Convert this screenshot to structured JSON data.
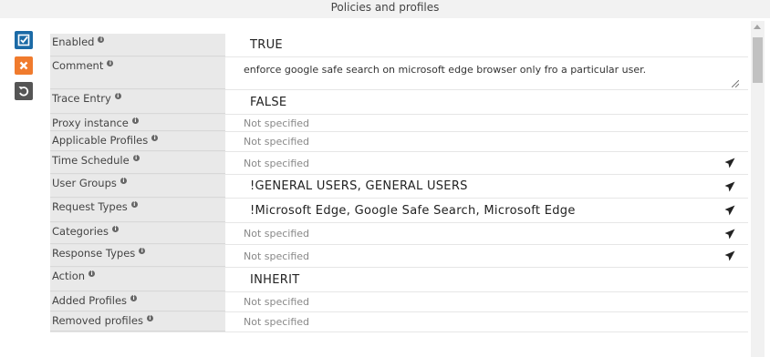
{
  "title": "Policies and profiles",
  "tools": {
    "save_icon": "check-square-icon",
    "cancel_icon": "close-icon",
    "revert_icon": "undo-icon"
  },
  "rows": [
    {
      "label": "Enabled",
      "value": "TRUE",
      "style": "big",
      "action": false
    },
    {
      "label": "Comment",
      "value": "enforce google safe search on microsoft edge browser only fro a particular user.",
      "style": "comment",
      "action": false
    },
    {
      "label": "Trace Entry",
      "value": "FALSE",
      "style": "big",
      "action": false
    },
    {
      "label": "Proxy instance",
      "value": "Not specified",
      "style": "ns",
      "action": false
    },
    {
      "label": "Applicable Profiles",
      "value": "Not specified",
      "style": "ns",
      "action": false
    },
    {
      "label": "Time Schedule",
      "value": "Not specified",
      "style": "ns",
      "action": true
    },
    {
      "label": "User Groups",
      "value": "!GENERAL USERS,   GENERAL USERS",
      "style": "big",
      "action": true
    },
    {
      "label": "Request Types",
      "value": "!Microsoft Edge,   Google Safe Search,   Microsoft Edge",
      "style": "big",
      "action": true
    },
    {
      "label": "Categories",
      "value": "Not specified",
      "style": "ns",
      "action": true
    },
    {
      "label": "Response Types",
      "value": "Not specified",
      "style": "ns",
      "action": true
    },
    {
      "label": "Action",
      "value": "INHERIT",
      "style": "big",
      "action": false
    },
    {
      "label": "Added Profiles",
      "value": "Not specified",
      "style": "ns",
      "action": false
    },
    {
      "label": "Removed profiles",
      "value": "Not specified",
      "style": "ns",
      "action": false
    }
  ],
  "info_glyph": "i"
}
